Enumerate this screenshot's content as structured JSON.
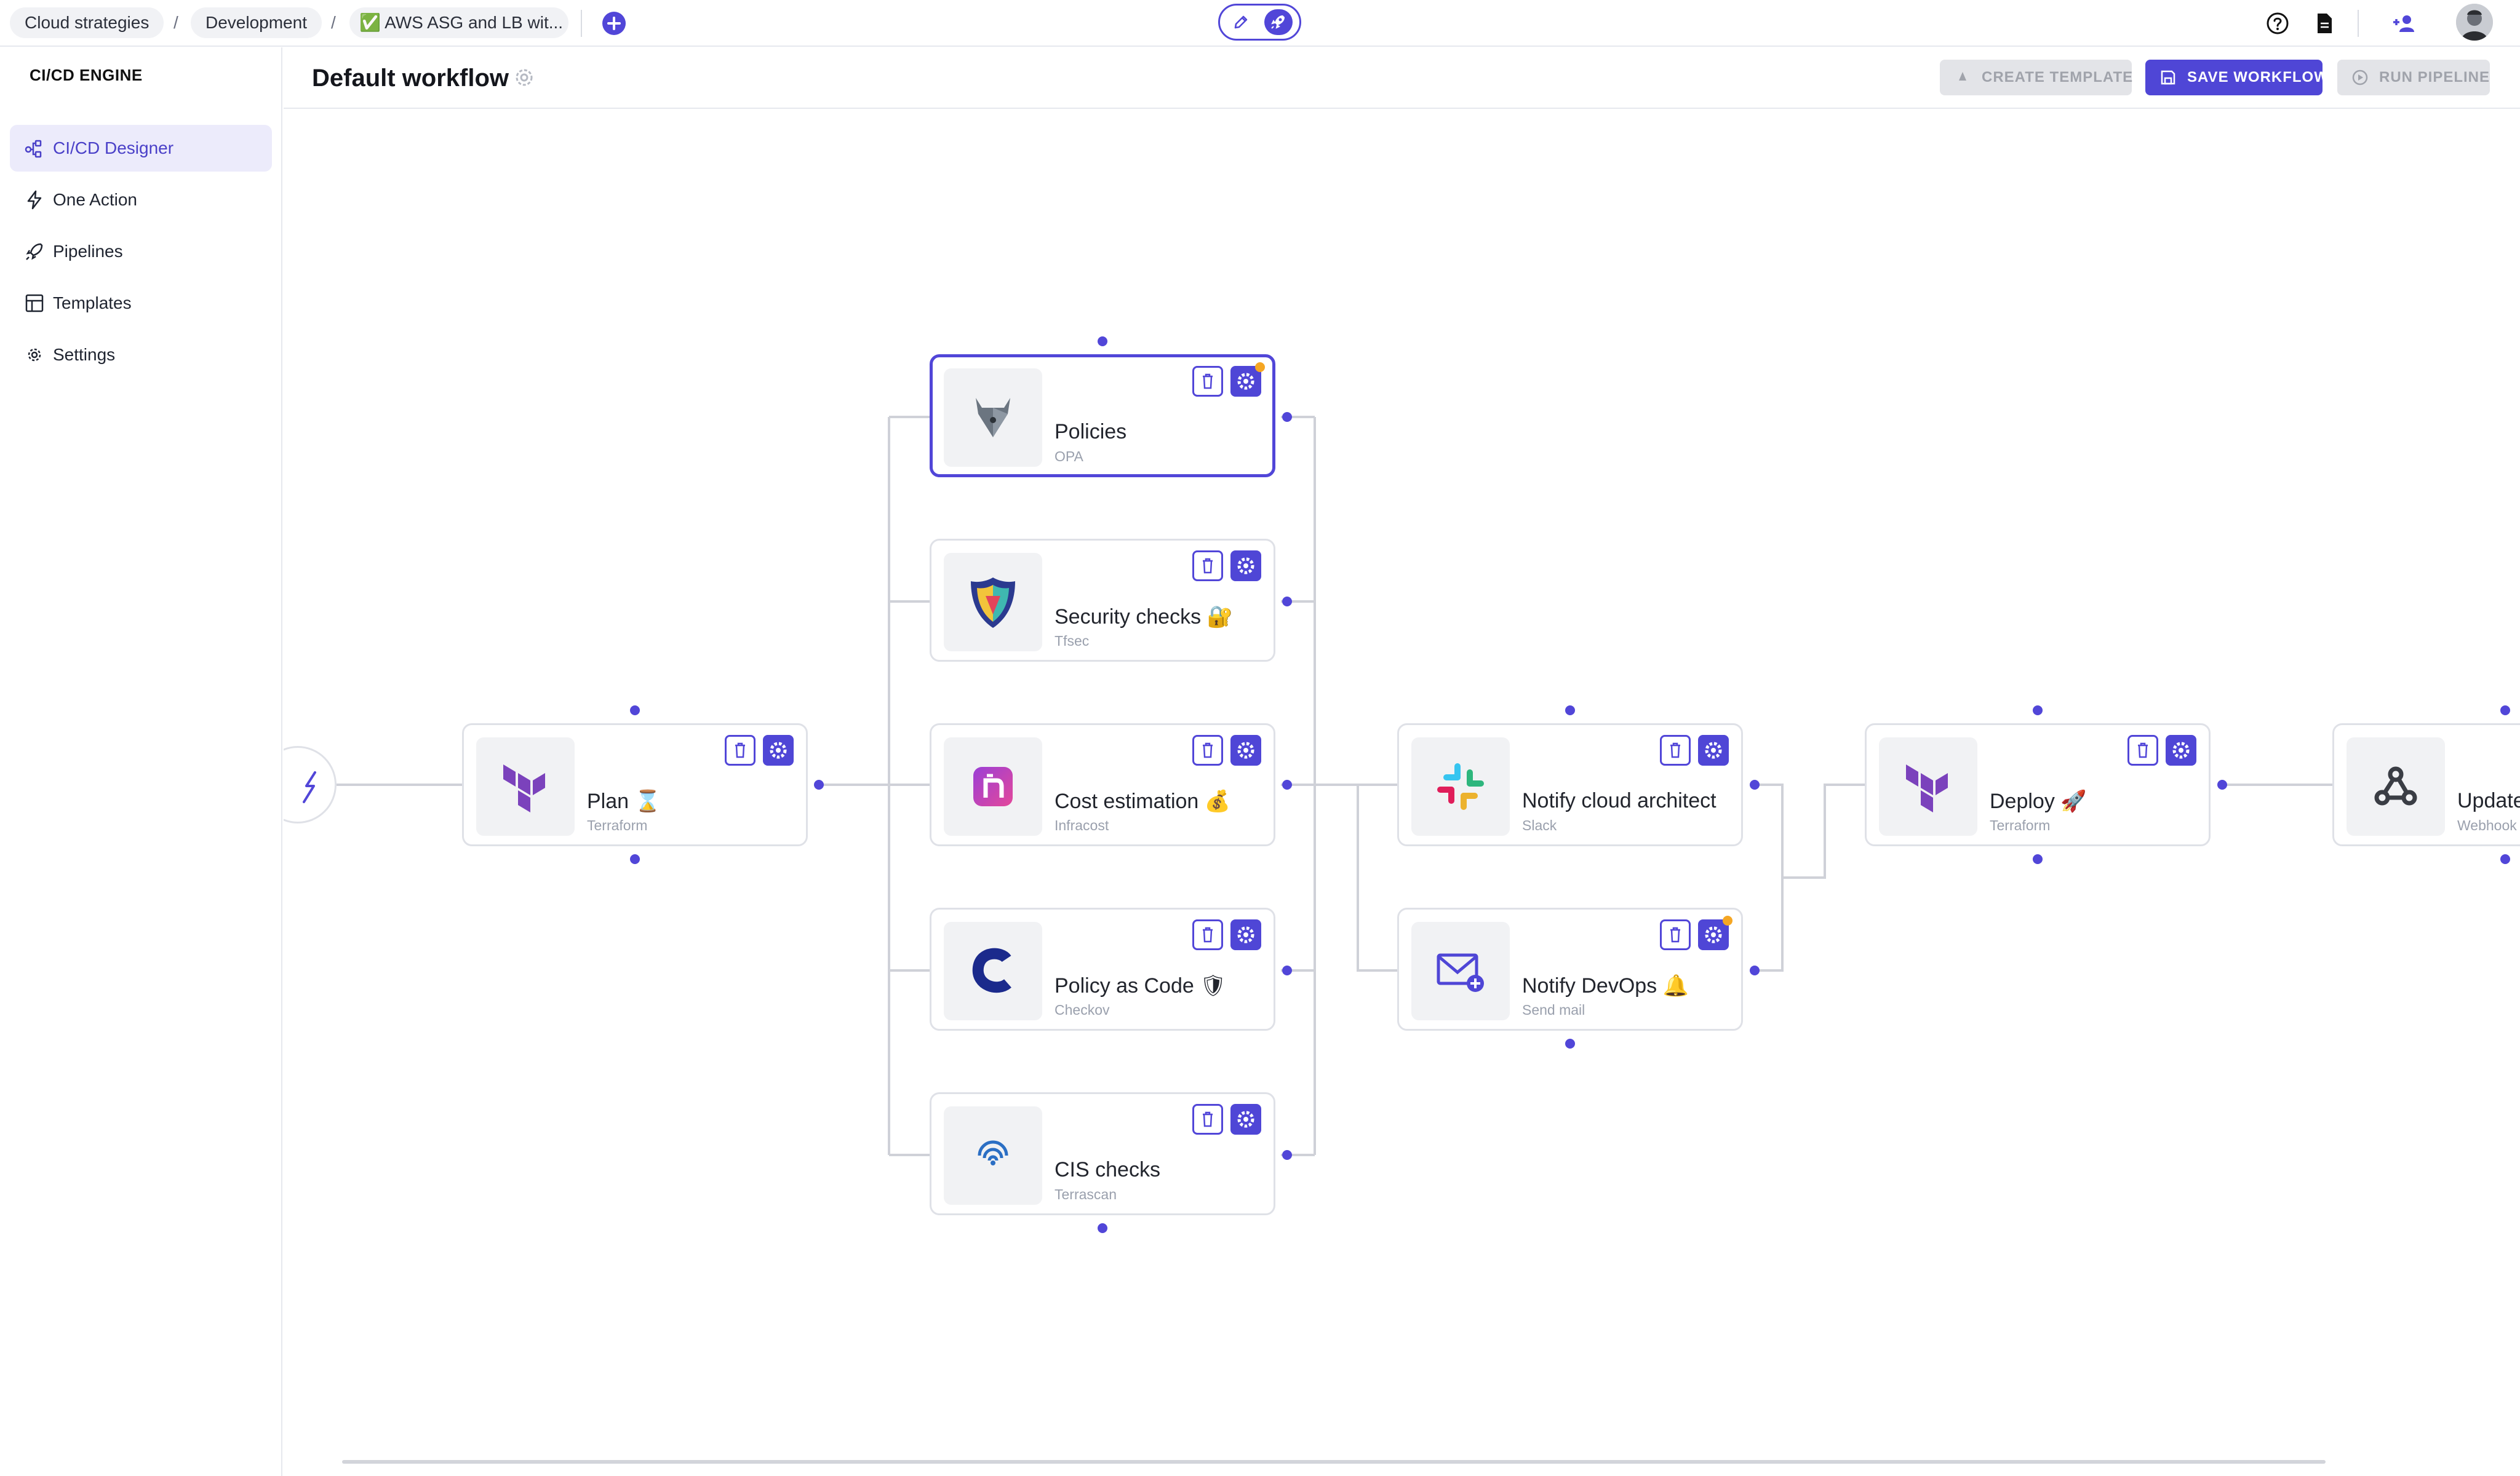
{
  "breadcrumbs": [
    "Cloud strategies",
    "Development",
    "✅ AWS ASG and LB wit..."
  ],
  "separator": "/",
  "sidebar": {
    "brand": "CI/CD ENGINE",
    "items": [
      {
        "label": "CI/CD Designer",
        "icon": "workflow-icon",
        "active": true
      },
      {
        "label": "One Action",
        "icon": "bolt-icon"
      },
      {
        "label": "Pipelines",
        "icon": "rocket-icon"
      },
      {
        "label": "Templates",
        "icon": "template-icon"
      },
      {
        "label": "Settings",
        "icon": "gear-icon"
      }
    ]
  },
  "header": {
    "title": "Default workflow",
    "create_template": "CREATE TEMPLATE",
    "save_workflow": "SAVE WORKFLOW",
    "run_pipeline": "RUN PIPELINE"
  },
  "nodes": {
    "plan": {
      "name": "Plan ⌛",
      "provider": "Terraform"
    },
    "policies": {
      "name": "Policies",
      "provider": "OPA"
    },
    "security": {
      "name": "Security checks 🔐",
      "provider": "Tfsec"
    },
    "cost": {
      "name": "Cost estimation 💰",
      "provider": "Infracost"
    },
    "pac": {
      "name": "Policy as Code 🛡",
      "provider": "Checkov"
    },
    "cis": {
      "name": "CIS checks",
      "provider": "Terrascan"
    },
    "notify_architect": {
      "name": "Notify cloud architect",
      "provider": "Slack"
    },
    "notify_devops": {
      "name": "Notify DevOps 🔔",
      "provider": "Send mail"
    },
    "deploy": {
      "name": "Deploy 🚀",
      "provider": "Terraform"
    },
    "update": {
      "name": "Update",
      "provider": "Webhook"
    }
  },
  "colors": {
    "accent": "#5146d8",
    "warning_dot": "#f5a623",
    "terraform": "#7b42bc"
  }
}
